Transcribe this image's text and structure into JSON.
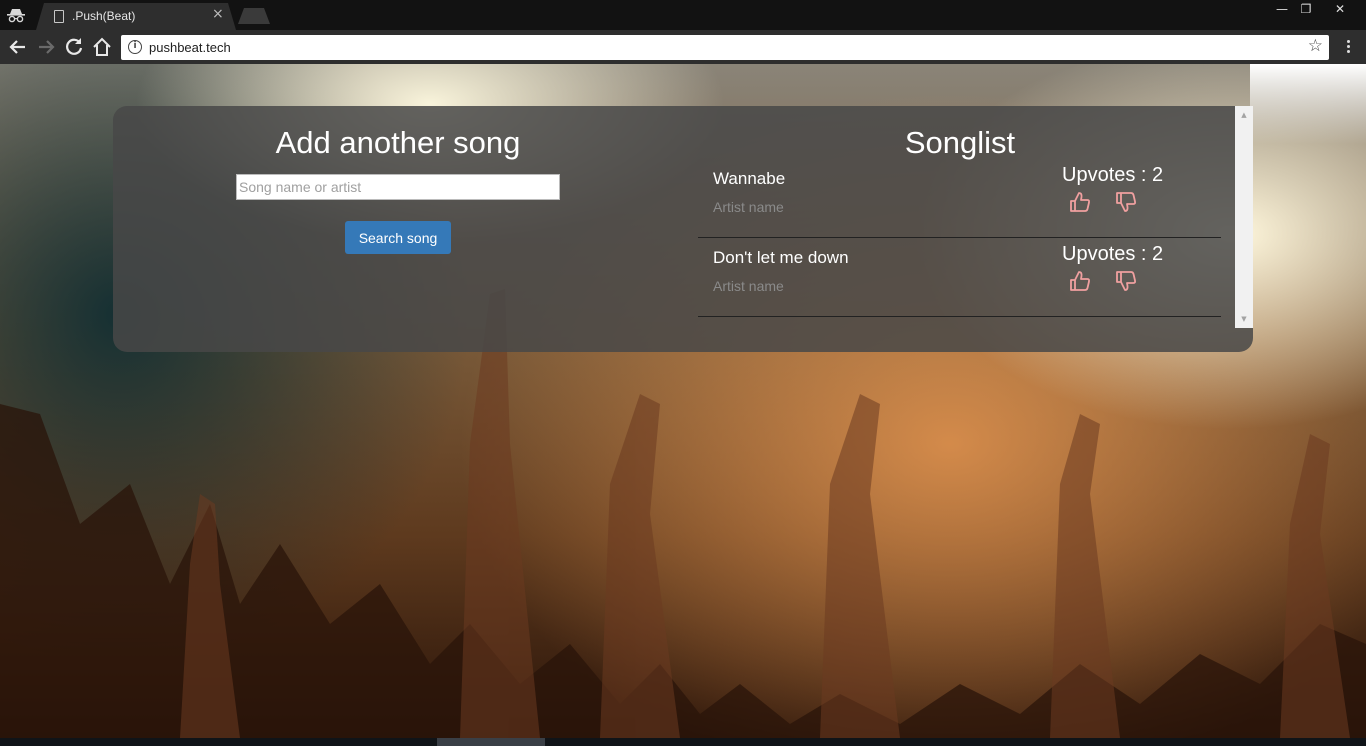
{
  "browser": {
    "tab_title": ".Push(Beat)",
    "tab_close": "×",
    "url": "pushbeat.tech",
    "info_glyph": "i",
    "star_glyph": "☆",
    "window_controls": {
      "minimize": "—",
      "restore": "❐",
      "close": "✕"
    }
  },
  "add_song": {
    "title": "Add another song",
    "search_placeholder": "Song name or artist",
    "search_value": "",
    "button_label": "Search song"
  },
  "songlist": {
    "title": "Songlist",
    "songs": [
      {
        "name": "Wannabe",
        "artist": "Artist name",
        "upvotes": "Upvotes : 2"
      },
      {
        "name": "Don't let me down",
        "artist": "Artist name",
        "upvotes": "Upvotes : 2"
      }
    ]
  },
  "colors": {
    "panel_bg": "#484848",
    "button_bg": "#3579b8",
    "thumb_icon": "#f0a0a0"
  },
  "icons": [
    "incognito-icon",
    "page-icon",
    "back-icon",
    "forward-icon",
    "reload-icon",
    "home-icon",
    "info-icon",
    "star-icon",
    "menu-icon",
    "thumbs-up-icon",
    "thumbs-down-icon"
  ]
}
